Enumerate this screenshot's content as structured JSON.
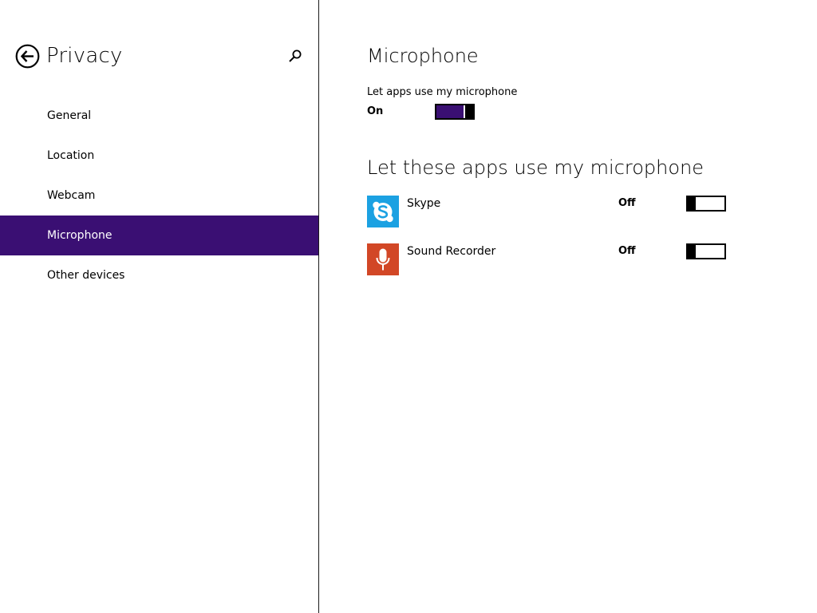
{
  "sidebar": {
    "title": "Privacy",
    "back_icon": "back-arrow-icon",
    "search_icon": "search-icon",
    "items": [
      {
        "label": "General",
        "selected": false
      },
      {
        "label": "Location",
        "selected": false
      },
      {
        "label": "Webcam",
        "selected": false
      },
      {
        "label": "Microphone",
        "selected": true
      },
      {
        "label": "Other devices",
        "selected": false
      }
    ]
  },
  "main": {
    "title": "Microphone",
    "master_setting": {
      "label": "Let apps use my microphone",
      "state_text": "On",
      "on": true
    },
    "apps_heading": "Let these apps use my microphone",
    "apps": [
      {
        "name": "Skype",
        "icon": "skype-icon",
        "state_text": "Off",
        "on": false
      },
      {
        "name": "Sound Recorder",
        "icon": "sound-recorder-icon",
        "state_text": "Off",
        "on": false
      }
    ]
  },
  "colors": {
    "accent": "#3a0f73",
    "skype": "#1ba1e2",
    "sound_recorder": "#d24726"
  }
}
